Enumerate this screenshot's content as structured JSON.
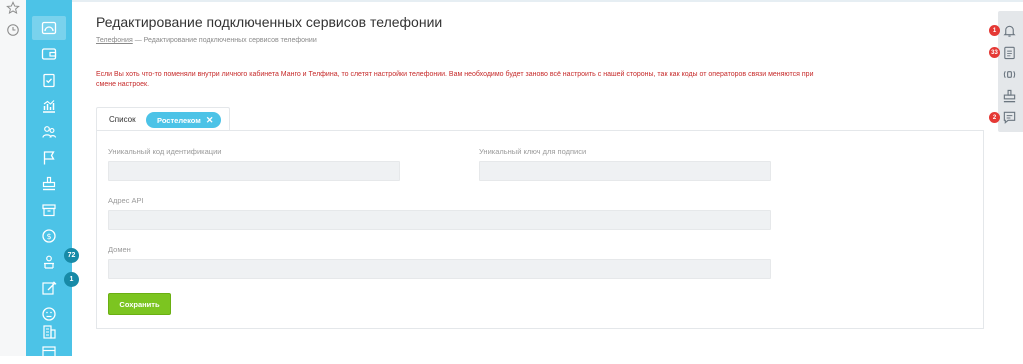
{
  "page": {
    "title": "Редактирование подключенных сервисов телефонии",
    "breadcrumb": {
      "link": "Телефония",
      "separator": " — ",
      "current": "Редактирование подключенных сервисов телефонии"
    },
    "warning": "Если Вы хоть что-то поменяли внутри личного кабинета Манго и Телфина, то слетят настройки телефонии. Вам необходимо будет заново всё настроить с нашей стороны, так как коды от операторов связи меняются при смене настроек."
  },
  "tabs": {
    "list_label": "Список",
    "active_chip": "Ростелеком",
    "chip_close": "✕"
  },
  "form": {
    "id_code_label": "Уникальный код идентификации",
    "id_code_value": "",
    "sign_key_label": "Уникальный ключ для подписи",
    "sign_key_value": "",
    "api_label": "Адрес API",
    "api_value": "",
    "domain_label": "Домен",
    "domain_value": "",
    "save_label": "Сохранить"
  },
  "sidebar": {
    "badges": [
      "72",
      "1"
    ]
  },
  "right_rail": {
    "badges": [
      "1",
      "33",
      "2"
    ]
  },
  "colors": {
    "sidebar": "#4cc3e7",
    "sidebar_badge": "#178aa7",
    "warning_text": "#c62a2a",
    "save_button": "#7cc520",
    "rail_badge": "#e53935"
  }
}
